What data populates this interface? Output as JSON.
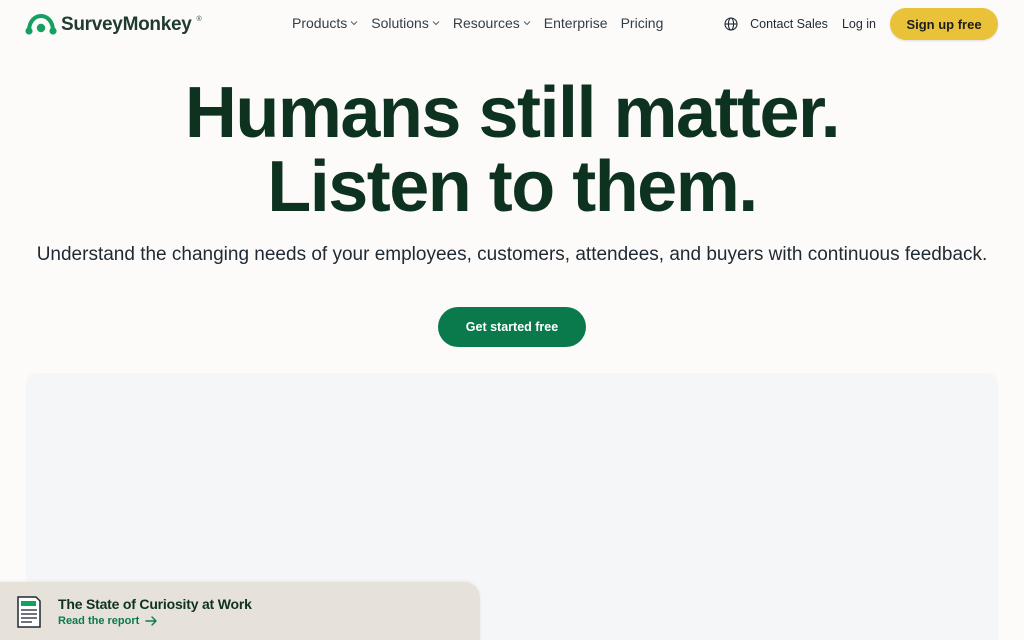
{
  "header": {
    "brand": "SurveyMonkey",
    "brand_mark": "®",
    "nav": [
      {
        "label": "Products",
        "has_menu": true
      },
      {
        "label": "Solutions",
        "has_menu": true
      },
      {
        "label": "Resources",
        "has_menu": true
      },
      {
        "label": "Enterprise",
        "has_menu": false
      },
      {
        "label": "Pricing",
        "has_menu": false
      }
    ],
    "globe_icon": "globe-icon",
    "contact_sales": "Contact Sales",
    "login": "Log in",
    "signup": "Sign up free"
  },
  "hero": {
    "headline_line1": "Humans still matter.",
    "headline_line2": "Listen to them.",
    "subhead": "Understand the changing needs of your employees, customers, attendees, and buyers with continuous feedback.",
    "cta": "Get started free"
  },
  "banner": {
    "icon": "document-icon",
    "title": "The State of Curiosity at Work",
    "link": "Read the report",
    "link_icon": "arrow-right-icon"
  },
  "colors": {
    "brand_green": "#0a7a4c",
    "headline": "#0e3220",
    "signup_yellow": "#e9c23a",
    "banner_bg": "#e6e2da"
  }
}
